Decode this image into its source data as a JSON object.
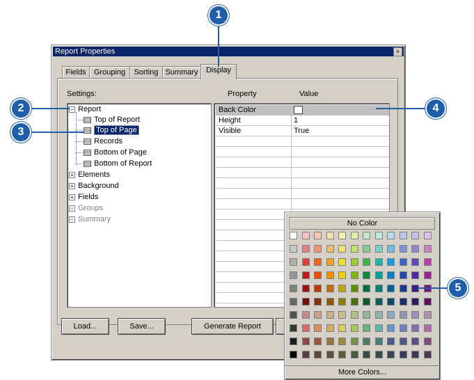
{
  "window": {
    "title": "Report Properties",
    "close_glyph": "×"
  },
  "tabs": [
    "Fields",
    "Grouping",
    "Sorting",
    "Summary",
    "Display"
  ],
  "labels": {
    "settings": "Settings:",
    "property": "Property",
    "value": "Value"
  },
  "tree": {
    "root": "Report",
    "children": [
      "Top of Report",
      "Top of Page",
      "Records",
      "Bottom of Page",
      "Bottom of Report"
    ],
    "selected": "Top of Page",
    "groups": [
      "Elements",
      "Background",
      "Fields",
      "Groups",
      "Summary"
    ],
    "disabled_groups": [
      "Groups",
      "Summary"
    ]
  },
  "grid": [
    {
      "property": "Back Color",
      "value": ""
    },
    {
      "property": "Height",
      "value": "1"
    },
    {
      "property": "Visible",
      "value": "True"
    }
  ],
  "buttons": {
    "load": "Load...",
    "save": "Save...",
    "generate": "Generate Report"
  },
  "palette": {
    "no_color": "No Color",
    "more_colors": "More Colors...",
    "colors": [
      [
        "#ffffff",
        "#f2c4c4",
        "#f6c8b0",
        "#f5deb0",
        "#f3f0b0",
        "#dcedb0",
        "#c4e6c8",
        "#c0e6e4",
        "#b8dcf0",
        "#bcc8ec",
        "#c8c0e6",
        "#e0c0e0"
      ],
      [
        "#c8c8c8",
        "#e08080",
        "#ec9870",
        "#f0bc70",
        "#ece470",
        "#c0e070",
        "#84cc90",
        "#7ccfcc",
        "#70bce8",
        "#7c94d8",
        "#9484cc",
        "#cc80c4"
      ],
      [
        "#b0b0b0",
        "#e04040",
        "#ec6820",
        "#f4a020",
        "#f2e020",
        "#98cc30",
        "#3cb450",
        "#20b4b0",
        "#1c9ce0",
        "#3c64c8",
        "#6448b4",
        "#b840a8"
      ],
      [
        "#989898",
        "#c81818",
        "#e05000",
        "#f09000",
        "#f0d000",
        "#7cb800",
        "#008c3c",
        "#00a09c",
        "#0080c8",
        "#2048b0",
        "#4c2c9c",
        "#a01c94"
      ],
      [
        "#808080",
        "#a01010",
        "#b83c00",
        "#c07000",
        "#c0a800",
        "#5c9000",
        "#00703c",
        "#008078",
        "#006098",
        "#183c8c",
        "#3c2080",
        "#801474"
      ],
      [
        "#686868",
        "#701010",
        "#803010",
        "#905808",
        "#908000",
        "#486c10",
        "#105830",
        "#106060",
        "#10486c",
        "#183068",
        "#301c60",
        "#601058"
      ],
      [
        "#505050",
        "#c08c8c",
        "#c8a090",
        "#c8b08c",
        "#c8c08c",
        "#b0c08c",
        "#94b49c",
        "#8cb4b0",
        "#8ca8c0",
        "#9098b8",
        "#9c90b4",
        "#b490b0"
      ],
      [
        "#383838",
        "#d06c6c",
        "#d88c64",
        "#d8a864",
        "#d8cc64",
        "#a8c864",
        "#6cb080",
        "#64b0ac",
        "#6498c8",
        "#6c80c0",
        "#8070b0",
        "#b06ca8"
      ],
      [
        "#202020",
        "#904848",
        "#985840",
        "#987440",
        "#988c40",
        "#78904c",
        "#4c7c5c",
        "#487c78",
        "#485c88",
        "#4c5888",
        "#5c4c84",
        "#804c7c"
      ],
      [
        "#000000",
        "#584040",
        "#604838",
        "#605438",
        "#605c38",
        "#4c5c38",
        "#384c40",
        "#384c4c",
        "#384458",
        "#383c58",
        "#403858",
        "#503850"
      ]
    ]
  },
  "callouts": [
    "1",
    "2",
    "3",
    "4",
    "5"
  ]
}
